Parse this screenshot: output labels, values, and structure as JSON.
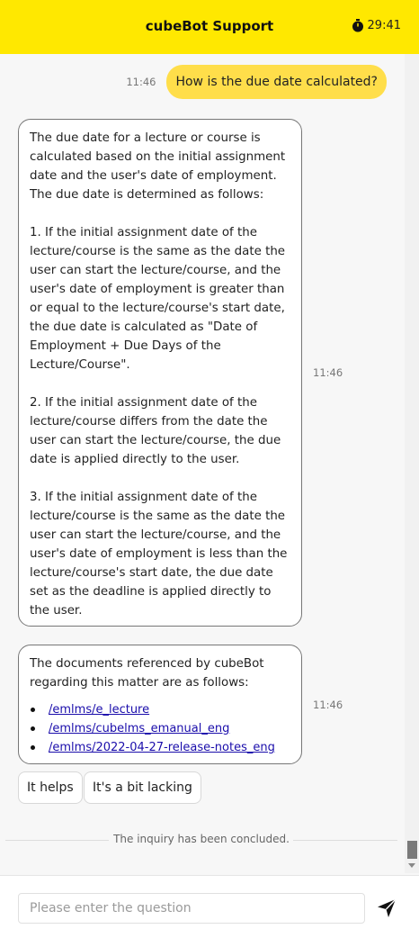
{
  "header": {
    "title": "cubeBot Support",
    "timer_icon": "stopwatch-icon",
    "timer_value": "29:41"
  },
  "messages": {
    "user_question": {
      "text": "How is the due date calculated?",
      "time": "11:46"
    },
    "bot_answer": {
      "text": "The due date for a lecture or course is calculated based on the initial assignment date and the user's date of employment. The due date is determined as follows:\n\n1. If the initial assignment date of the lecture/course is the same as the date the user can start the lecture/course, and the user's date of employment is greater than or equal to the lecture/course's start date, the due date is calculated as \"Date of Employment + Due Days of the Lecture/Course\".\n\n2. If the initial assignment date of the lecture/course differs from the date the user can start the lecture/course, the due date is applied directly to the user.\n\n3. If the initial assignment date of the lecture/course is the same as the date the user can start the lecture/course, and the user's date of employment is less than the lecture/course's start date, the due date set as the deadline is applied directly to the user.",
      "time": "11:46"
    },
    "bot_references": {
      "intro": "The documents referenced by cubeBot regarding this matter are as follows:",
      "links": [
        "/emlms/e_lecture",
        "/emlms/cubelms_emanual_eng",
        "/emlms/2022-04-27-release-notes_eng"
      ],
      "time": "11:46"
    }
  },
  "feedback": {
    "helps": "It helps",
    "lacking": "It's a bit lacking"
  },
  "status": {
    "concluded": "The inquiry has been concluded."
  },
  "composer": {
    "placeholder": "Please enter the question",
    "send_icon": "send-icon"
  },
  "colors": {
    "header_bg": "#ffe800",
    "user_bubble": "#ffde4a",
    "link": "#1a0dab"
  }
}
